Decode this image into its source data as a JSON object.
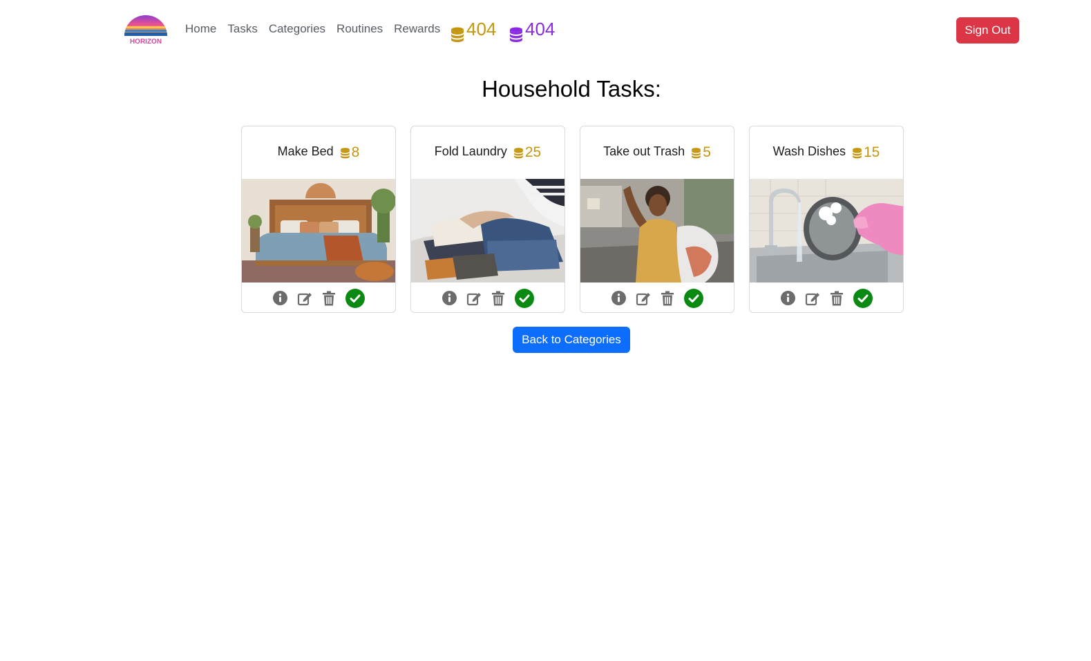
{
  "nav": {
    "logo_text": "HORIZON",
    "links": [
      "Home",
      "Tasks",
      "Categories",
      "Routines",
      "Rewards"
    ],
    "gold_coins": "404",
    "purple_coins": "404",
    "sign_out_label": "Sign Out"
  },
  "page": {
    "title": "Household Tasks:",
    "back_label": "Back to Categories"
  },
  "tasks": [
    {
      "title": "Make Bed",
      "points": "8",
      "image": "bedroom with made bed"
    },
    {
      "title": "Fold Laundry",
      "points": "25",
      "image": "folding clothes"
    },
    {
      "title": "Take out Trash",
      "points": "5",
      "image": "woman carrying trash bag"
    },
    {
      "title": "Wash Dishes",
      "points": "15",
      "image": "washing dish at sink"
    }
  ],
  "colors": {
    "gold": "#c5960f",
    "purple": "#8a2be2",
    "danger": "#dc3545",
    "primary": "#0d6efd",
    "success": "#0a8a12",
    "icon_gray": "#6c6c6c"
  }
}
